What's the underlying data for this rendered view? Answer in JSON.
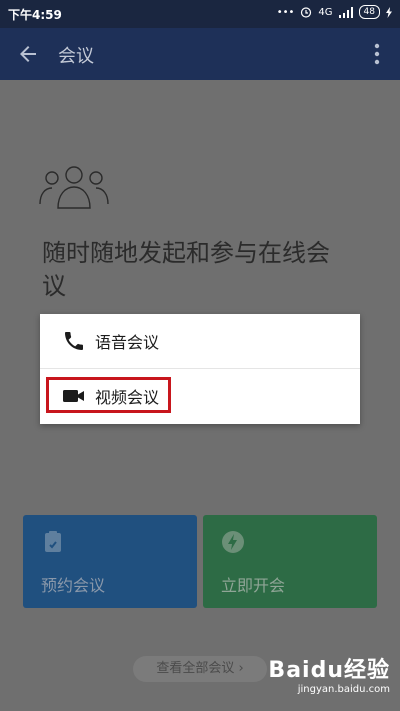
{
  "status_bar": {
    "time": "下午4:59",
    "dots": "•••",
    "network": "4G",
    "battery": "48"
  },
  "app_bar": {
    "title": "会议"
  },
  "hero": {
    "tagline": "随时随地发起和参与在线会议"
  },
  "dialog": {
    "items": [
      {
        "label": "语音会议",
        "icon": "phone-icon"
      },
      {
        "label": "视频会议",
        "icon": "video-camera-icon"
      }
    ]
  },
  "actions": {
    "schedule_label": "预约会议",
    "instant_label": "立即开会"
  },
  "view_all": {
    "label": "查看全部会议 ›"
  },
  "watermark": {
    "brand": "Baidu经验",
    "url": "jingyan.baidu.com"
  },
  "colors": {
    "appbar": "#1e3058",
    "highlight": "#c8161d",
    "schedule": "#20507f",
    "instant": "#2d6b45"
  }
}
